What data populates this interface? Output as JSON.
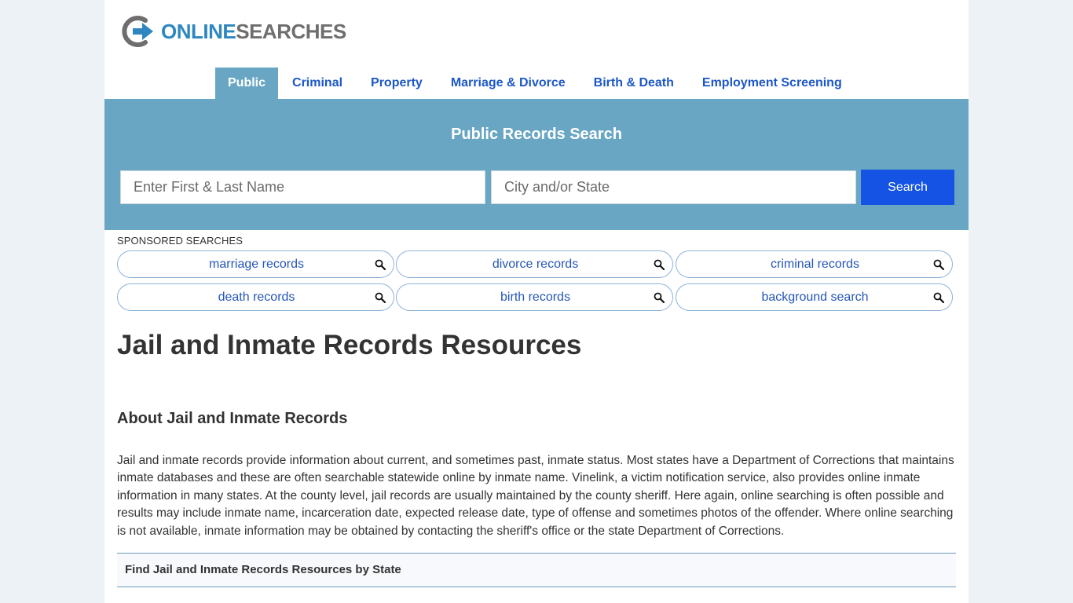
{
  "logo": {
    "word1": "ONLINE",
    "word2": "SEARCHES",
    "colors": {
      "word1": "#2f87c0",
      "word2": "#6e6e6e"
    }
  },
  "nav": {
    "items": [
      {
        "label": "Public",
        "active": true
      },
      {
        "label": "Criminal"
      },
      {
        "label": "Property"
      },
      {
        "label": "Marriage & Divorce"
      },
      {
        "label": "Birth & Death"
      },
      {
        "label": "Employment Screening"
      }
    ]
  },
  "search": {
    "title": "Public Records Search",
    "name_placeholder": "Enter First & Last Name",
    "city_placeholder": "City and/or State",
    "button_label": "Search"
  },
  "sponsored": {
    "label": "SPONSORED SEARCHES",
    "items": [
      "marriage records",
      "divorce records",
      "criminal records",
      "death records",
      "birth records",
      "background search"
    ]
  },
  "content": {
    "title": "Jail and Inmate Records Resources",
    "section_title": "About Jail and Inmate Records",
    "paragraph": "Jail and inmate records provide information about current, and sometimes past, inmate status. Most states have a Department of Corrections that maintains inmate databases and these are often searchable statewide online by inmate name. Vinelink, a victim notification service, also provides online inmate information in many states. At the county level, jail records are usually maintained by the county sheriff. Here again, online searching is often possible and results may include inmate name, incarceration date, expected release date, type of offense and sometimes photos of the offender. Where online searching is not available, inmate information may be obtained by contacting the sheriff's office or the state Department of Corrections.",
    "state_box_title": "Find Jail and Inmate Records Resources by State"
  },
  "colors": {
    "accent": "#69a6c3",
    "nav_link": "#1c57c7",
    "button": "#1453e4",
    "pill_border": "#8fb3d9",
    "pill_text": "#2556b8"
  }
}
